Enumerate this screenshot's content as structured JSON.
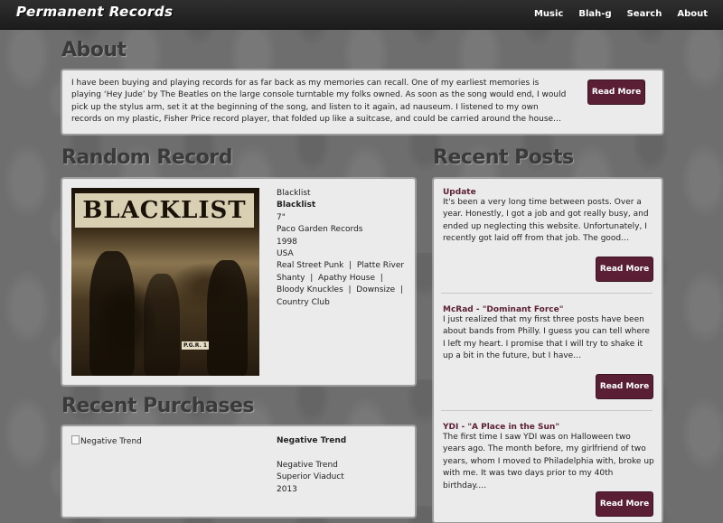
{
  "brand": "Permanent Records",
  "nav": [
    "Music",
    "Blah-g",
    "Search",
    "About"
  ],
  "about": {
    "heading": "About",
    "text": "I have been buying and playing records for as far back as my memories can recall. One of my earliest memories is playing ‘Hey Jude’ by The Beatles on the large console turntable my folks owned. As soon as the song would end, I would pick up the stylus arm, set it at the beginning of the song, and listen to it again, ad nauseum. I listened to my own records on my plastic, Fisher Price record player, that folded up like a suitcase, and could be carried around the house…",
    "button": "Read More"
  },
  "random_record": {
    "heading": "Random Record",
    "cover_title": "BLACKLIST",
    "cover_sticker": "P.G.R. 1",
    "artist": "Blacklist",
    "title": "Blacklist",
    "format": "7\"",
    "label": "Paco Garden Records",
    "year": "1998",
    "country": "USA",
    "tags": "Real Street Punk  |  Platte River Shanty  |  Apathy House  |  Bloody Knuckles  |  Downsize  |  Country Club"
  },
  "recent_posts": {
    "heading": "Recent Posts",
    "posts": [
      {
        "title": "Update",
        "excerpt": "It's been a very long time between posts. Over a year. Honestly, I got a job and got really busy, and ended up neglecting this website. Unfortunately, I recently got laid off from that job. The good…",
        "button": "Read More"
      },
      {
        "title": "McRad - \"Dominant Force\"",
        "excerpt": "I just realized that my first three posts have been about bands from Philly. I guess you can tell where I left my heart. I promise that I will try to shake it up a bit in the future, but I have…",
        "button": "Read More"
      },
      {
        "title": "YDI - \"A Place in the Sun\"",
        "excerpt": "The first time I saw YDI was on Halloween two years ago. The month before, my girlfriend of two years, whom I moved to Philadelphia with, broke up with me. It was two days prior to my 40th birthday.…",
        "button": "Read More"
      }
    ]
  },
  "recent_purchases": {
    "heading": "Recent Purchases",
    "image_alt": "Negative Trend",
    "artist": "Negative Trend",
    "title": "Negative Trend",
    "label": "Superior Viaduct",
    "year": "2013"
  }
}
